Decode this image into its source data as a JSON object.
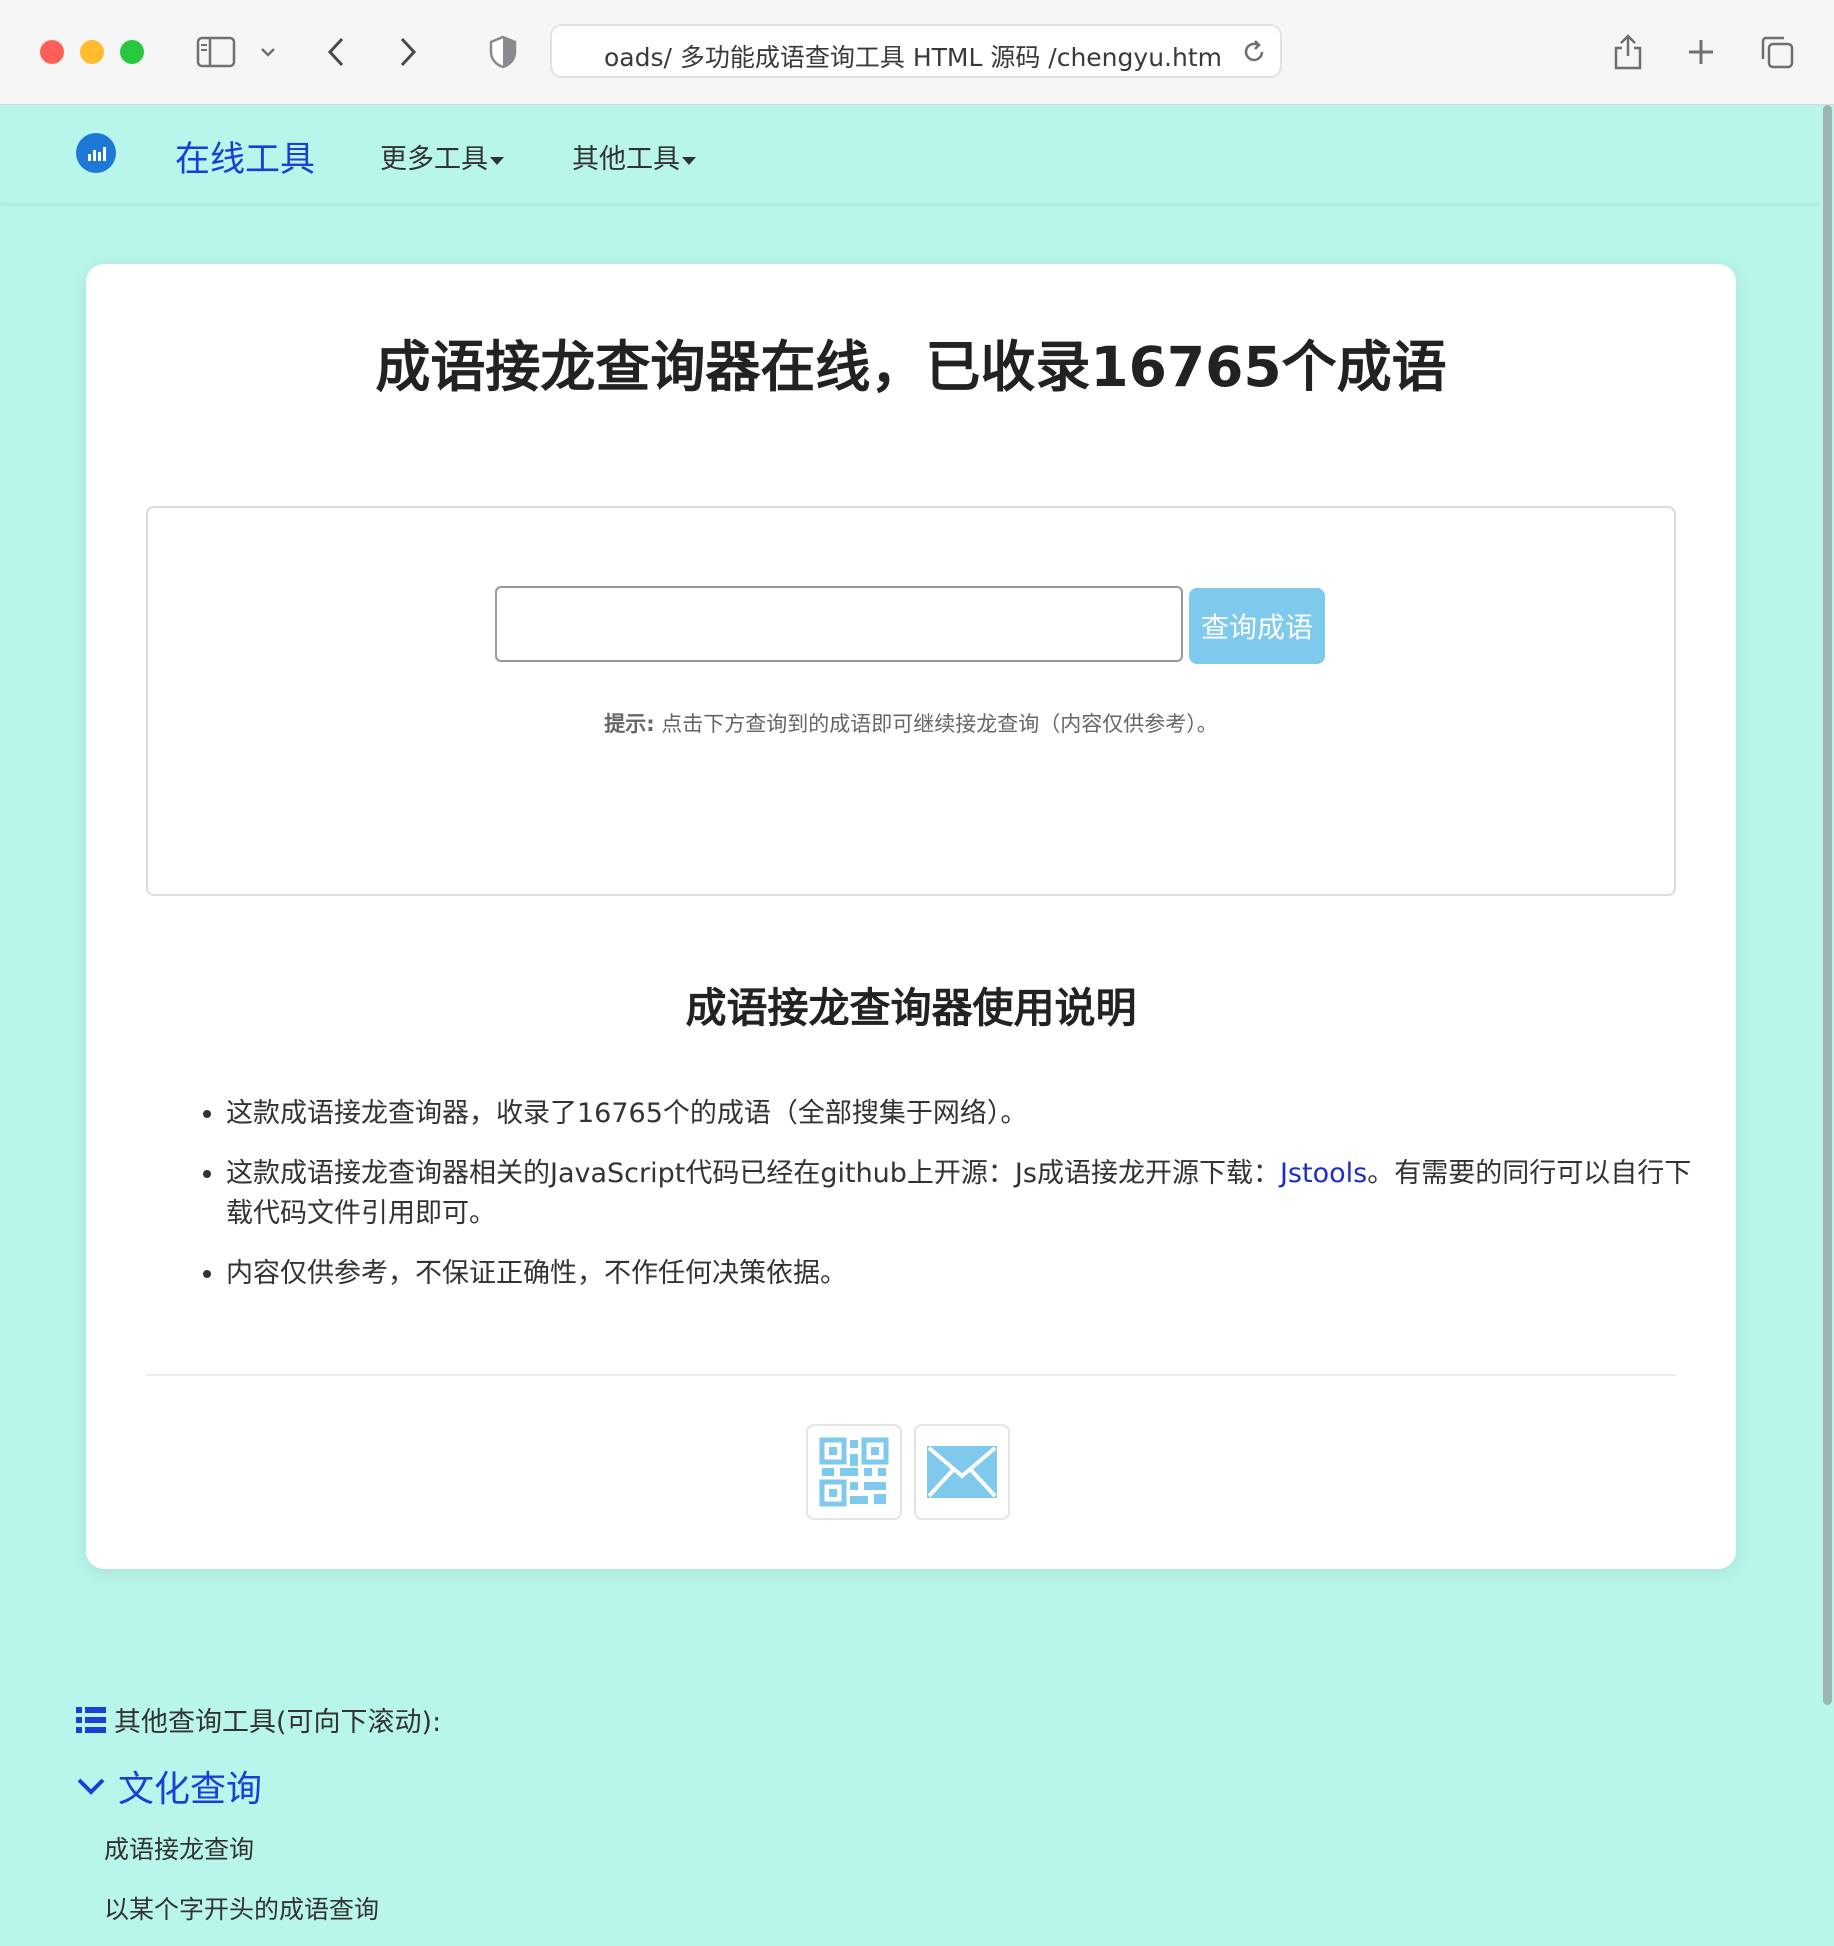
{
  "browser": {
    "url": "oads/ 多功能成语查询工具 HTML 源码 /chengyu.html"
  },
  "nav": {
    "brand": "在线工具",
    "menus": [
      {
        "label": "更多工具"
      },
      {
        "label": "其他工具"
      }
    ]
  },
  "main": {
    "title": "成语接龙查询器在线，已收录16765个成语",
    "search": {
      "value": "",
      "placeholder": "",
      "button_label": "查询成语"
    },
    "hint_label": "提示:",
    "hint_text": "点击下方查询到的成语即可继续接龙查询（内容仅供参考）。",
    "section_title": "成语接龙查询器使用说明",
    "notes": [
      "这款成语接龙查询器，收录了16765个的成语（全部搜集于网络）。",
      "这款成语接龙查询器相关的JavaScript代码已经在github上开源：Js成语接龙开源下载：",
      "内容仅供参考，不保证正确性，不作任何决策依据。"
    ],
    "note2_link": "Jstools",
    "note2_suffix": "。有需要的同行可以自行下载代码文件引用即可。",
    "footer_icons": [
      "qr-code-icon",
      "mail-icon"
    ]
  },
  "other_tools": {
    "heading": "其他查询工具(可向下滚动):",
    "category": "文化查询",
    "items": [
      {
        "label": "成语接龙查询"
      },
      {
        "label": "以某个字开头的成语查询"
      }
    ]
  },
  "colors": {
    "page_bg": "#b8f5ea",
    "brand": "#1a3fd6",
    "button": "#7ec9ec"
  }
}
